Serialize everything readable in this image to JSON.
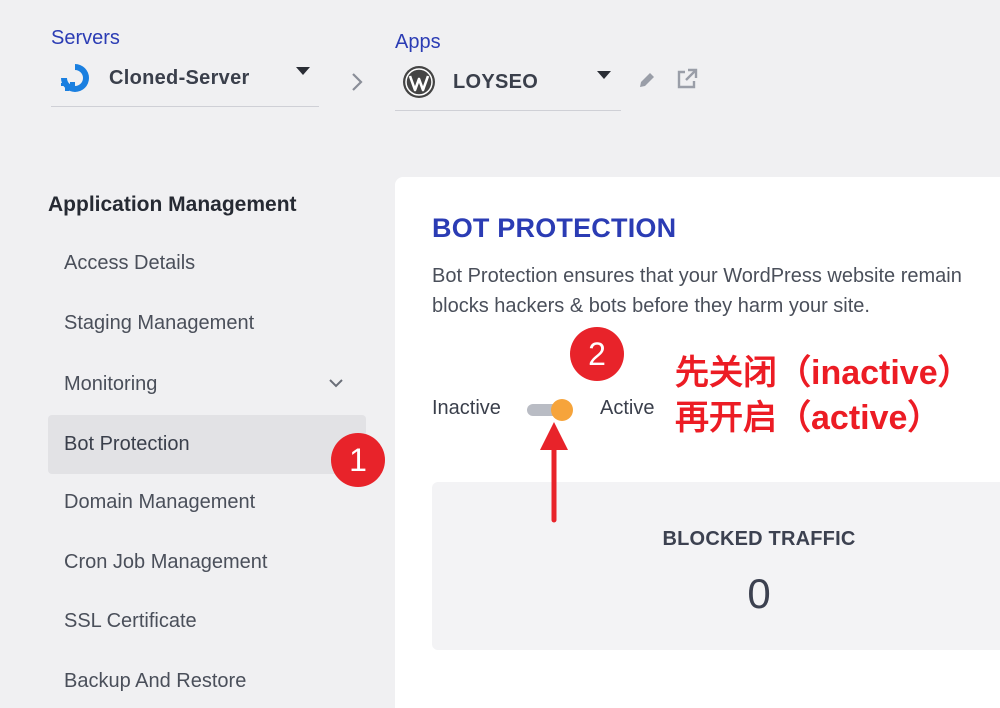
{
  "header": {
    "servers": {
      "label": "Servers",
      "value": "Cloned-Server",
      "icon": "digitalocean-icon"
    },
    "apps": {
      "label": "Apps",
      "value": "LOYSEO",
      "icon": "wordpress-icon"
    },
    "tools": [
      "edit-icon",
      "external-link-icon"
    ]
  },
  "sidebar": {
    "title": "Application Management",
    "items": [
      {
        "label": "Access Details"
      },
      {
        "label": "Staging Management"
      },
      {
        "label": "Monitoring",
        "expandable": true
      },
      {
        "label": "Bot Protection",
        "active": true
      },
      {
        "label": "Domain Management"
      },
      {
        "label": "Cron Job Management"
      },
      {
        "label": "SSL Certificate"
      },
      {
        "label": "Backup And Restore"
      }
    ]
  },
  "main": {
    "title": "BOT PROTECTION",
    "description_line1": "Bot Protection ensures that your WordPress website remain",
    "description_line2": "blocks hackers & bots before they harm your site.",
    "toggle": {
      "off_label": "Inactive",
      "on_label": "Active",
      "state": "active"
    },
    "stat": {
      "label": "BLOCKED TRAFFIC",
      "value": "0"
    }
  },
  "annotations": {
    "badge1": "1",
    "badge2": "2",
    "note_line1": "先关闭（inactive）",
    "note_line2": "再开启（active）"
  },
  "colors": {
    "accent_blue": "#2b3cb4",
    "toggle_knob": "#f6a43b",
    "annotation_red": "#e8232a",
    "background": "#f0f0f2",
    "panel": "#ffffff"
  }
}
